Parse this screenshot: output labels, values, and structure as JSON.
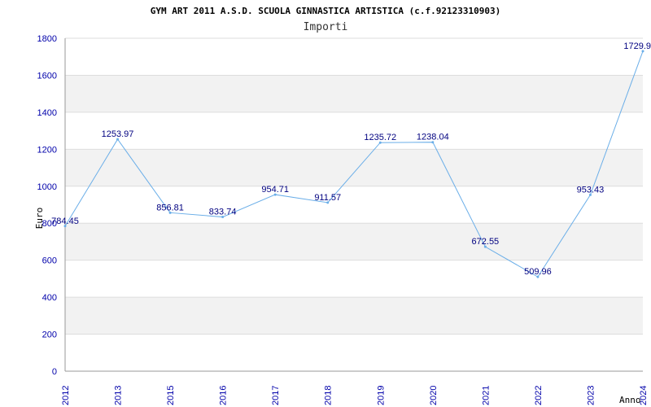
{
  "chart_data": {
    "type": "line",
    "title": "GYM ART 2011 A.S.D. SCUOLA GINNASTICA ARTISTICA (c.f.92123310903)",
    "subtitle": "Importi",
    "xlabel": "Anno",
    "ylabel": "Euro",
    "ylim": [
      0,
      1800
    ],
    "yticks": [
      0,
      200,
      400,
      600,
      800,
      1000,
      1200,
      1400,
      1600,
      1800
    ],
    "grid": true,
    "categories": [
      "2012",
      "2013",
      "2015",
      "2016",
      "2017",
      "2018",
      "2019",
      "2020",
      "2021",
      "2022",
      "2023",
      "2024"
    ],
    "values": [
      784.45,
      1253.97,
      856.81,
      833.74,
      954.71,
      911.57,
      1235.72,
      1238.04,
      672.55,
      509.96,
      953.43,
      1729.9
    ],
    "value_labels": [
      "784.45",
      "1253.97",
      "856.81",
      "833.74",
      "954.71",
      "911.57",
      "1235.72",
      "1238.04",
      "672.55",
      "509.96",
      "953.43",
      "1729.9"
    ],
    "colors": {
      "line": "#6aaee8",
      "band": "#f2f2f2",
      "grid": "#dddddd",
      "axis": "#999999",
      "tick_text": "#0000aa",
      "data_label": "#000080"
    }
  }
}
